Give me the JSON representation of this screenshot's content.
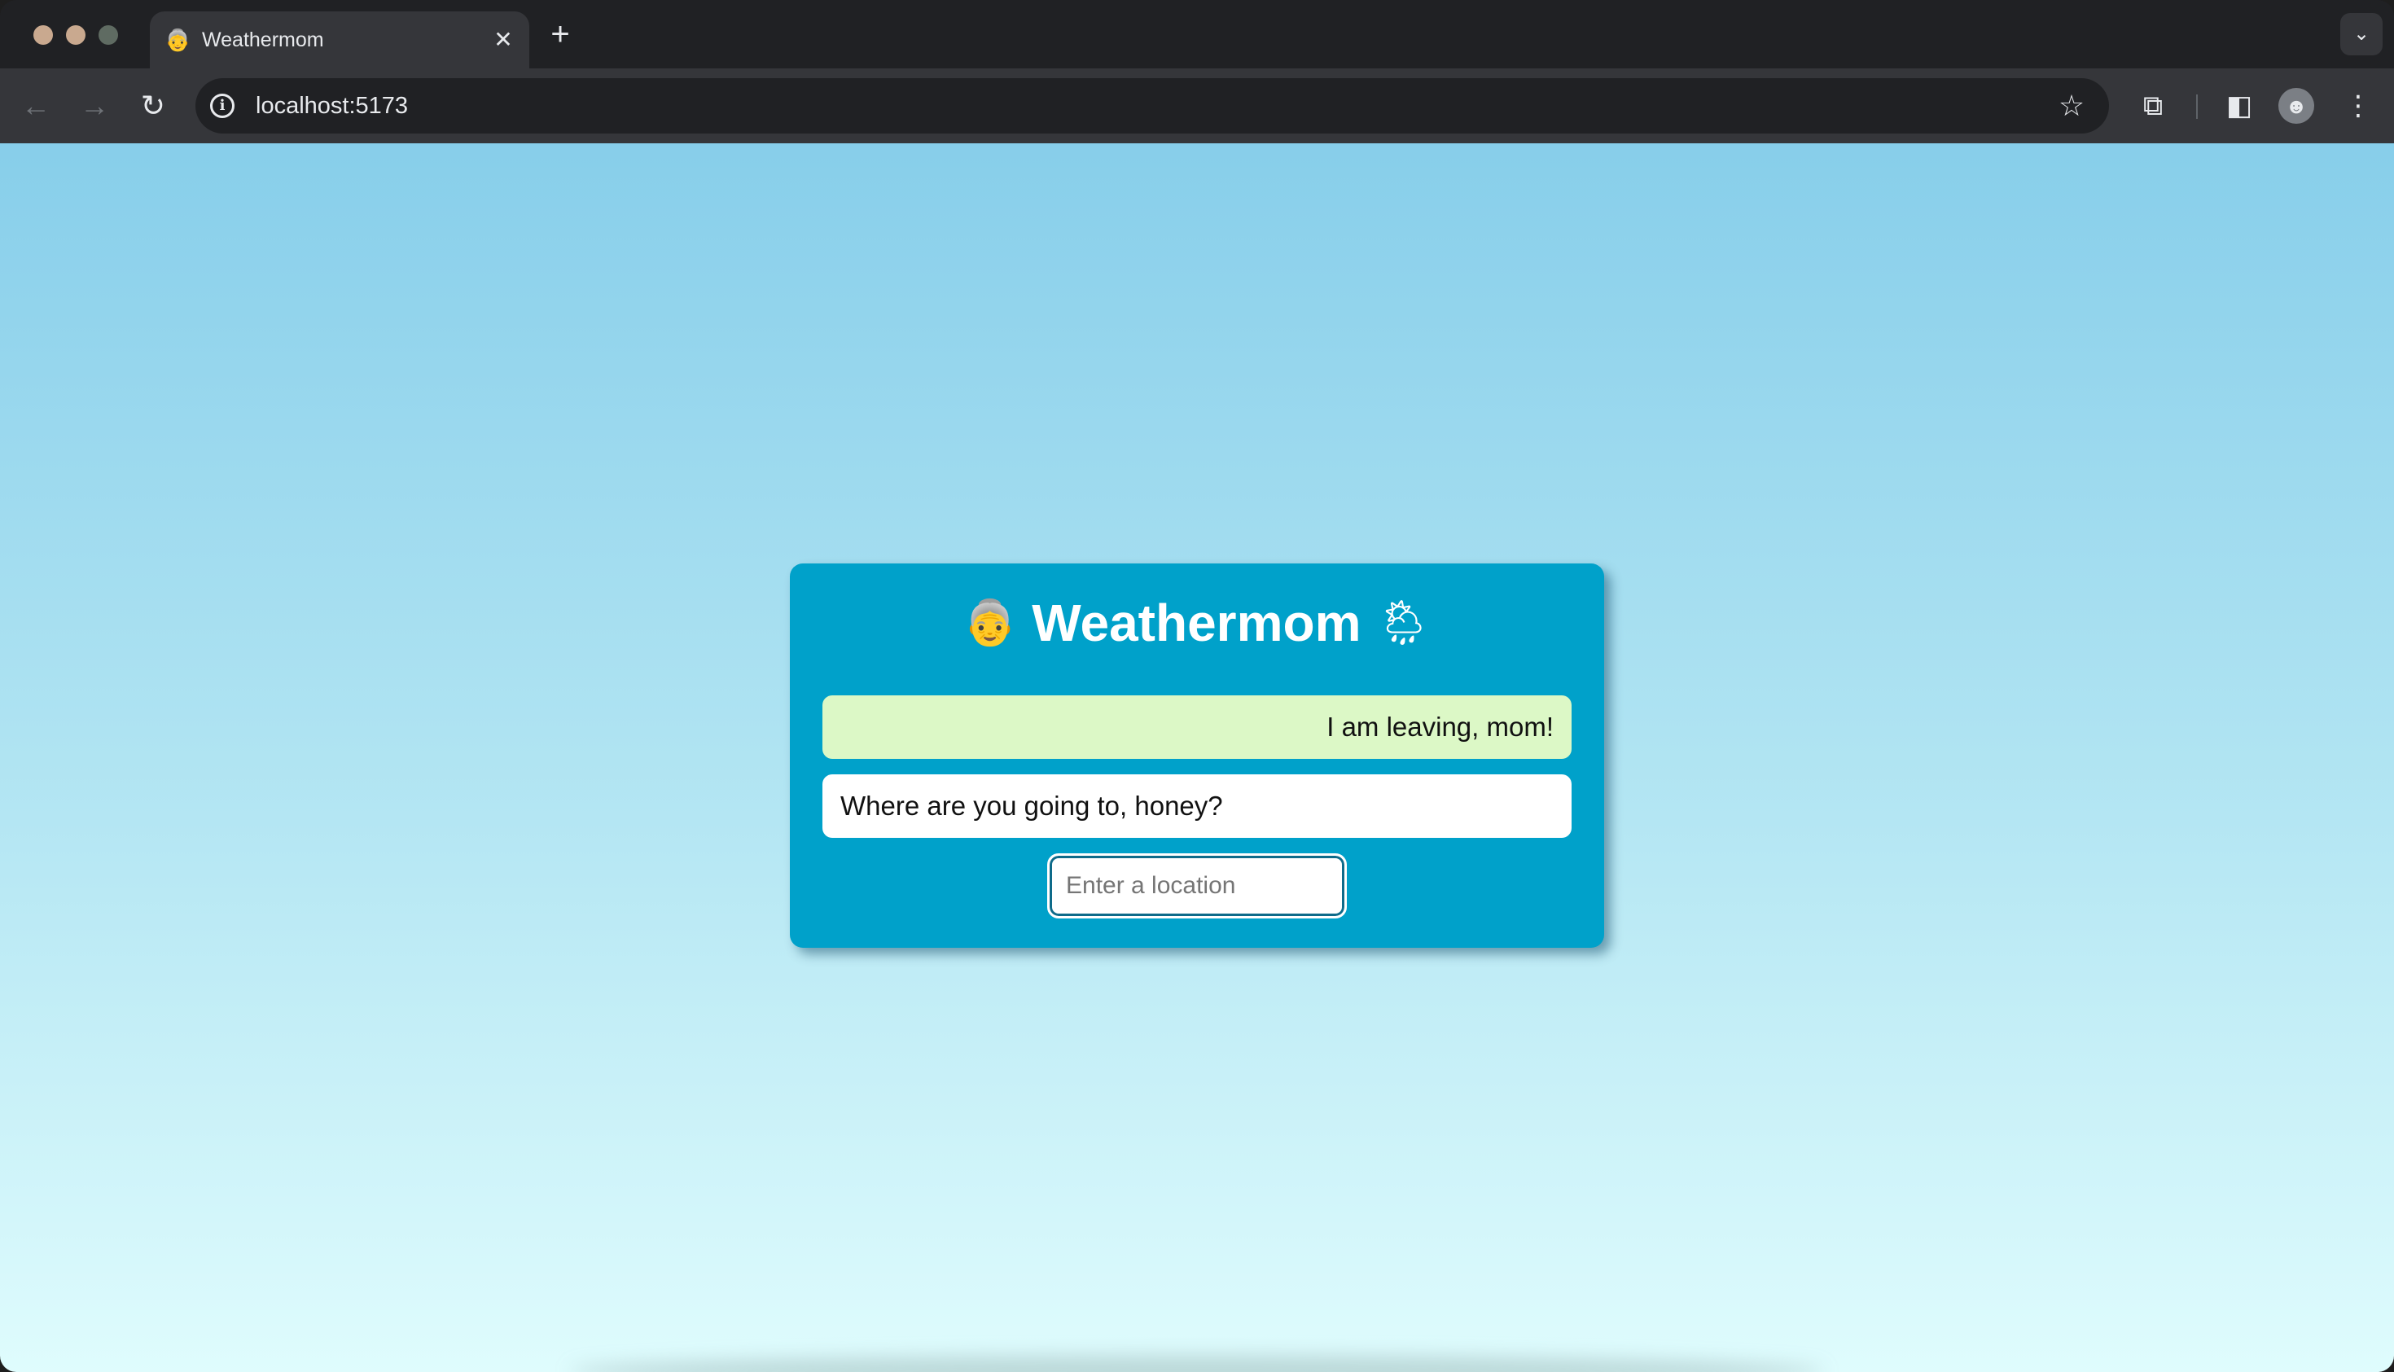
{
  "browser": {
    "tab_favicon": "👵",
    "tab_title": "Weathermom",
    "tab_close": "✕",
    "new_tab": "+",
    "tab_menu": "⌄",
    "url": "localhost:5173",
    "icons": {
      "back": "←",
      "forward": "→",
      "reload": "↻",
      "site_info": "i",
      "bookmark": "☆",
      "extensions": "⧉",
      "side_panel": "◧",
      "profile": "☻",
      "menu": "⋮"
    }
  },
  "app": {
    "title_emoji_left": "👵",
    "title": "Weathermom",
    "title_emoji_right": "🌦",
    "messages": [
      {
        "from": "user",
        "text": "I am leaving, mom!"
      },
      {
        "from": "mom",
        "text": "Where are you going to, honey?"
      }
    ],
    "location_input": {
      "placeholder": "Enter a location",
      "value": ""
    }
  },
  "colors": {
    "card": "#00a1ca",
    "user_bubble": "#dcf8c6",
    "mom_bubble": "#ffffff",
    "page_top": "#87ceea",
    "page_bottom": "#dffcfd"
  }
}
